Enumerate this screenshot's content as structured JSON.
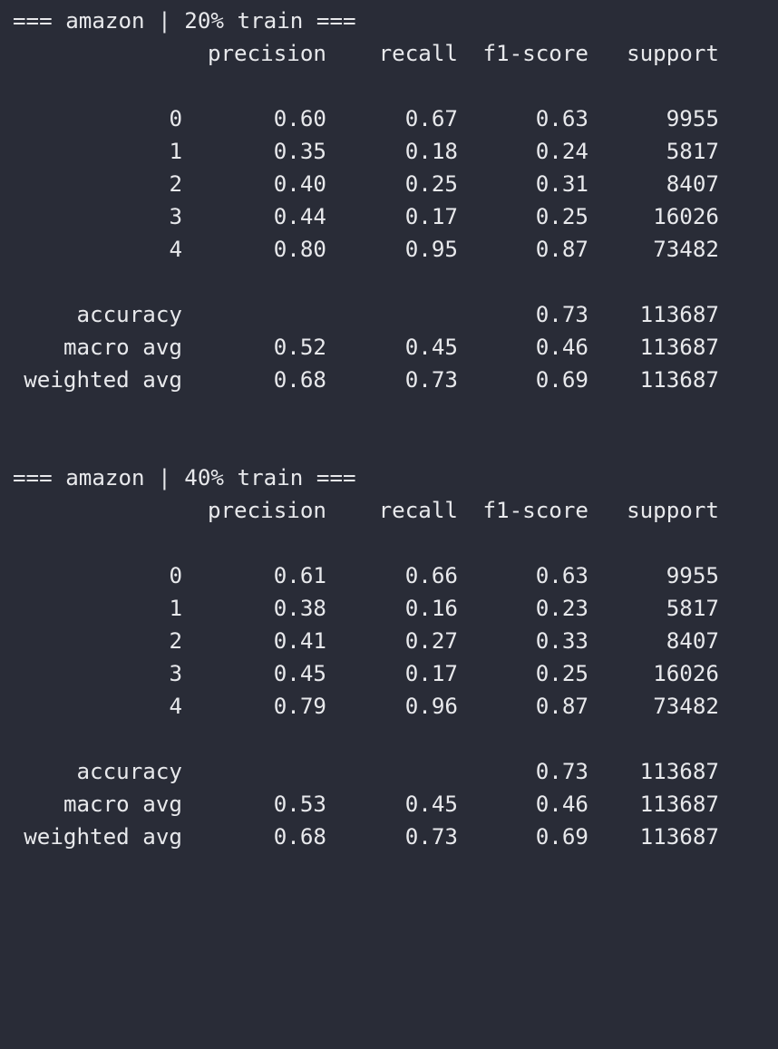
{
  "reports": [
    {
      "title": "=== amazon | 20% train ===",
      "headers": {
        "precision": "precision",
        "recall": "recall",
        "f1": "f1-score",
        "support": "support"
      },
      "rows": [
        {
          "label": "0",
          "precision": "0.60",
          "recall": "0.67",
          "f1": "0.63",
          "support": "9955"
        },
        {
          "label": "1",
          "precision": "0.35",
          "recall": "0.18",
          "f1": "0.24",
          "support": "5817"
        },
        {
          "label": "2",
          "precision": "0.40",
          "recall": "0.25",
          "f1": "0.31",
          "support": "8407"
        },
        {
          "label": "3",
          "precision": "0.44",
          "recall": "0.17",
          "f1": "0.25",
          "support": "16026"
        },
        {
          "label": "4",
          "precision": "0.80",
          "recall": "0.95",
          "f1": "0.87",
          "support": "73482"
        }
      ],
      "summary": [
        {
          "label": "accuracy",
          "precision": "",
          "recall": "",
          "f1": "0.73",
          "support": "113687"
        },
        {
          "label": "macro avg",
          "precision": "0.52",
          "recall": "0.45",
          "f1": "0.46",
          "support": "113687"
        },
        {
          "label": "weighted avg",
          "precision": "0.68",
          "recall": "0.73",
          "f1": "0.69",
          "support": "113687"
        }
      ]
    },
    {
      "title": "=== amazon | 40% train ===",
      "headers": {
        "precision": "precision",
        "recall": "recall",
        "f1": "f1-score",
        "support": "support"
      },
      "rows": [
        {
          "label": "0",
          "precision": "0.61",
          "recall": "0.66",
          "f1": "0.63",
          "support": "9955"
        },
        {
          "label": "1",
          "precision": "0.38",
          "recall": "0.16",
          "f1": "0.23",
          "support": "5817"
        },
        {
          "label": "2",
          "precision": "0.41",
          "recall": "0.27",
          "f1": "0.33",
          "support": "8407"
        },
        {
          "label": "3",
          "precision": "0.45",
          "recall": "0.17",
          "f1": "0.25",
          "support": "16026"
        },
        {
          "label": "4",
          "precision": "0.79",
          "recall": "0.96",
          "f1": "0.87",
          "support": "73482"
        }
      ],
      "summary": [
        {
          "label": "accuracy",
          "precision": "",
          "recall": "",
          "f1": "0.73",
          "support": "113687"
        },
        {
          "label": "macro avg",
          "precision": "0.53",
          "recall": "0.45",
          "f1": "0.46",
          "support": "113687"
        },
        {
          "label": "weighted avg",
          "precision": "0.68",
          "recall": "0.73",
          "f1": "0.69",
          "support": "113687"
        }
      ]
    }
  ]
}
